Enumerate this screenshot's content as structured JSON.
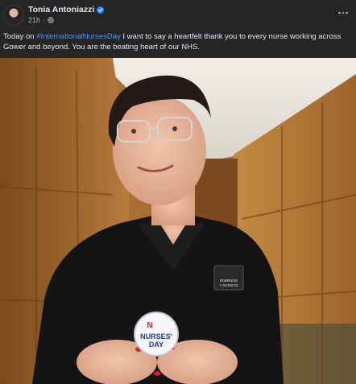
{
  "post": {
    "author": {
      "name": "Tonia Antoniazzi",
      "verified": true,
      "avatar_icon": "profile-photo"
    },
    "timestamp": "21h",
    "audience_icon": "globe-icon",
    "caption": {
      "prefix": "Today on ",
      "hashtag": "#InternationalNursesDay",
      "suffix": " I want to say a heartfelt thank you to every nurse working across Gower and beyond. You are the beating heart of our NHS."
    },
    "photo": {
      "badge_line1": "NURSES'",
      "badge_line2": "DAY",
      "badge_logo": "N",
      "name_badge_line1": "DIWRNOD",
      "name_badge_line2": "Y NYRSYS"
    }
  },
  "colors": {
    "background": "#242526",
    "text_primary": "#e4e6eb",
    "text_secondary": "#b0b3b8",
    "link": "#4599ff",
    "verified": "#2d88ff"
  }
}
